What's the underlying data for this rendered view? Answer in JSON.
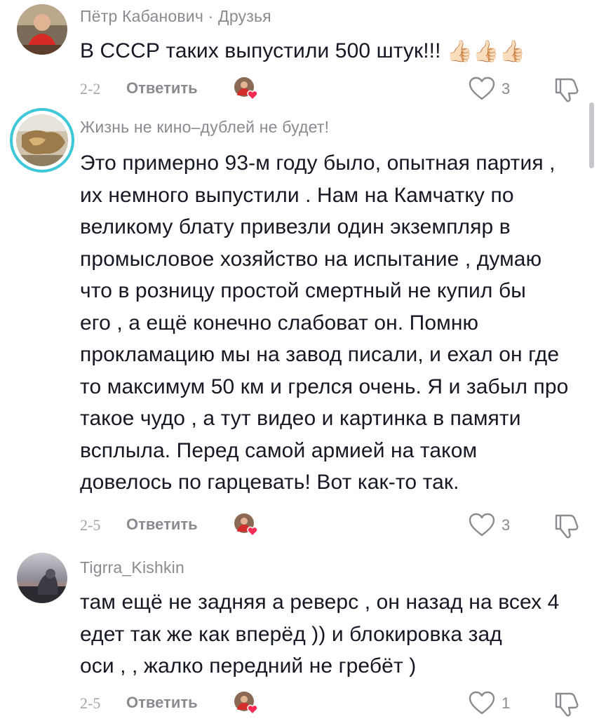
{
  "comments": [
    {
      "username": "Пётр Кабанович · Друзья",
      "lines": [
        "В СССР таких выпустили 500 штук!!!"
      ],
      "trailing_emoji": "👍🏻👍🏻👍🏻",
      "date": "2-2",
      "reply_label": "Ответить",
      "likes": "3"
    },
    {
      "username": "Жизнь не кино–дублей не будет!",
      "lines": [
        "Это примерно 93-м году было, опытная партия ,",
        "их немного выпустили . Нам на Камчатку по",
        "великому блату привезли один экземпляр в",
        "промысловое хозяйство на испытание , думаю",
        "что в розницу простой смертный не купил бы",
        "его , а ещё конечно слабоват он. Помню",
        "прокламацию мы на завод писали, и ехал он где",
        "то максимум 50 км и грелся очень. Я и забыл про",
        "такое чудо , а тут видео и картинка в памяти",
        "всплыла. Перед самой армией на таком",
        "довелось по гарцевать! Вот как-то так."
      ],
      "date": "2-5",
      "reply_label": "Ответить",
      "likes": "3"
    },
    {
      "username": "Tigrra_Kishkin",
      "lines": [
        "там ещё не задняя а реверс , он назад на всех 4",
        "едет так же как вперёд )) и блокировка зад",
        "оси , , жалко передний не гребёт )"
      ],
      "date": "2-5",
      "reply_label": "Ответить",
      "likes": "1"
    }
  ],
  "icons": {
    "like": "heart-outline-icon",
    "dislike": "thumbs-down-outline-icon",
    "creator_like": "creator-liked-avatar-icon"
  },
  "colors": {
    "text": "#161823",
    "muted": "#8a8b91",
    "heart_badge": "#fe2c55",
    "ring": "#3ec7d8"
  }
}
